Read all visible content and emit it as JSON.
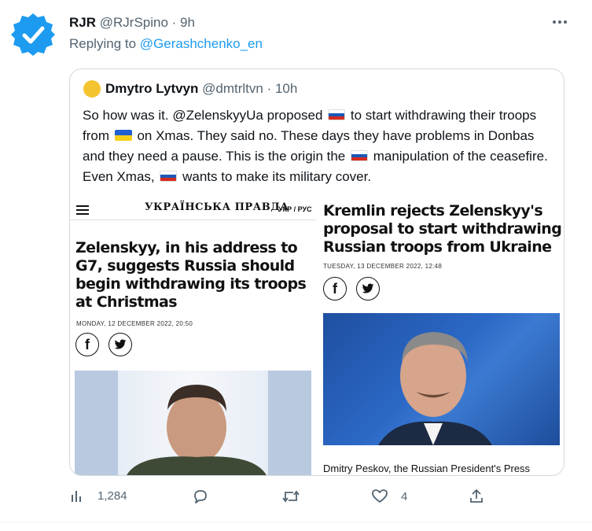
{
  "tweet": {
    "author_name": "RJR",
    "author_handle": "@RJrSpino",
    "separator": " · ",
    "time": "9h",
    "replying_prefix": "Replying to ",
    "replying_to": "@Gerashchenko_en",
    "more_icon": "more-horizontal-icon"
  },
  "quote": {
    "author_name": "Dmytro Lytvyn",
    "author_handle": "@dmtrltvn",
    "separator": " · ",
    "time": "10h",
    "text": {
      "p1": "So how was it. @ZelenskyyUa proposed ",
      "p2": " to start withdrawing their troops from ",
      "p3": " on Xmas. They said no. These days they have problems in Donbas and they need a pause. This is the origin the ",
      "p4": " manipulation of the ceasefire. Even Xmas, ",
      "p5": " wants to make its military cover."
    },
    "flags": [
      "russia-flag-icon",
      "ukraine-flag-icon",
      "russia-flag-icon",
      "russia-flag-icon"
    ]
  },
  "article_left": {
    "masthead": "УКРАЇНСЬКА ПРАВДА",
    "languages": "УКР / РУС",
    "headline": "Zelenskyy, in his address to G7, suggests Russia should begin withdrawing its troops at Christmas",
    "date": "MONDAY, 12 DECEMBER 2022, 20:50",
    "facebook": "f"
  },
  "article_right": {
    "headline": "Kremlin rejects Zelenskyy's proposal to start withdrawing Russian troops from Ukraine",
    "date": "TUESDAY, 13 DECEMBER 2022, 12:48",
    "facebook": "f",
    "caption": "Dmitry Peskov, the Russian President's Press"
  },
  "actions": {
    "views": "1,284",
    "replies": "",
    "retweets": "",
    "likes": "4"
  },
  "colors": {
    "accent": "#1d9bf0",
    "muted": "#536471",
    "border": "#cfd9de"
  }
}
